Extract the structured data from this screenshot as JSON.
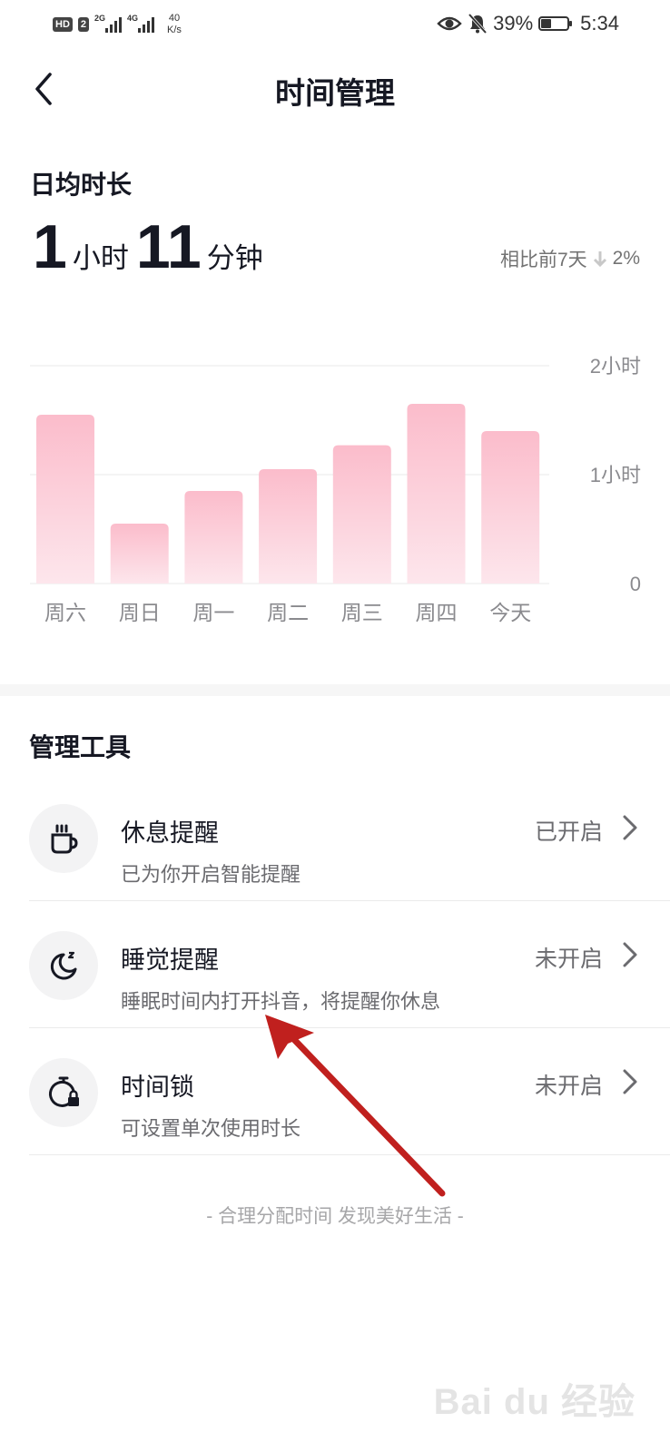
{
  "status_bar": {
    "hd": "HD",
    "sim": "2",
    "net1": "2G",
    "net2": "4G",
    "speed_value": "40",
    "speed_unit": "K/s",
    "battery": "39%",
    "battery_level": 0.39,
    "time": "5:34"
  },
  "header": {
    "title": "时间管理"
  },
  "summary": {
    "section_title": "日均时长",
    "hours": "1",
    "hours_unit": "小时",
    "minutes": "11",
    "minutes_unit": "分钟",
    "compare_label": "相比前7天",
    "compare_value": "2%"
  },
  "chart_data": {
    "type": "bar",
    "categories": [
      "周六",
      "周日",
      "周一",
      "周二",
      "周三",
      "周四",
      "今天"
    ],
    "values": [
      1.55,
      0.55,
      0.85,
      1.05,
      1.27,
      1.65,
      1.4
    ],
    "y_unit": "hours",
    "ylim": [
      0,
      2
    ],
    "y_ticks": [
      {
        "value": 2,
        "label": "2小时"
      },
      {
        "value": 1,
        "label": "1小时"
      },
      {
        "value": 0,
        "label": "0"
      }
    ],
    "grid": true,
    "bar_color_top": "#fbbccb",
    "bar_color_bottom": "#fde6ec"
  },
  "tools": {
    "section_title": "管理工具",
    "items": [
      {
        "name": "休息提醒",
        "desc": "已为你开启智能提醒",
        "status": "已开启",
        "icon": "coffee-cup-icon"
      },
      {
        "name": "睡觉提醒",
        "desc": "睡眠时间内打开抖音，将提醒你休息",
        "status": "未开启",
        "icon": "moon-zz-icon"
      },
      {
        "name": "时间锁",
        "desc": "可设置单次使用时长",
        "status": "未开启",
        "icon": "timer-lock-icon"
      }
    ]
  },
  "footer": {
    "slogan": "- 合理分配时间 发现美好生活 -"
  },
  "watermark": {
    "text": "Bai du 经验"
  },
  "colors": {
    "annotation_arrow": "#c0201e",
    "text_primary": "#161823",
    "text_secondary": "#6b6b6f"
  }
}
